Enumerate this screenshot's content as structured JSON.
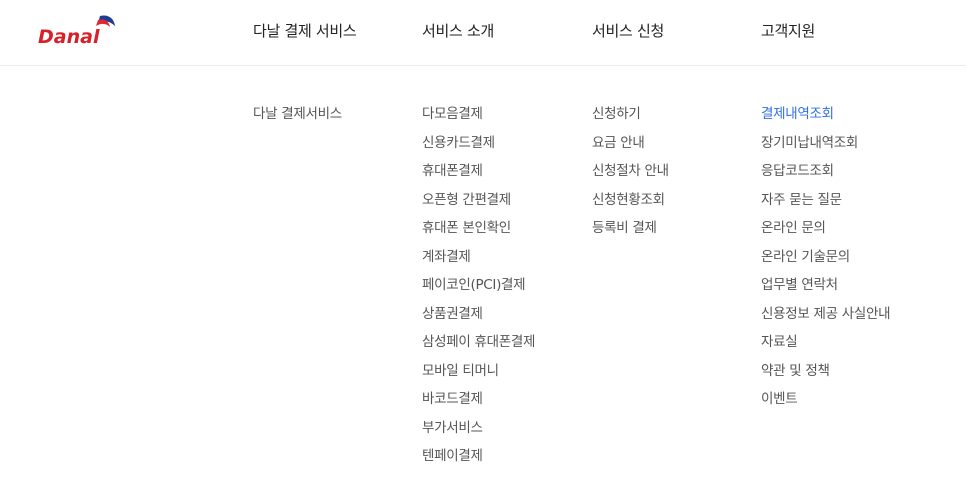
{
  "brand": {
    "logo_text": "Danal",
    "colors": {
      "text": "#d8202a",
      "wing_red": "#e4272d",
      "wing_blue": "#1b3e94"
    }
  },
  "gnb": [
    "다날 결제 서비스",
    "서비스 소개",
    "서비스 신청",
    "고객지원"
  ],
  "submenu": {
    "danal_payment": [
      "다날 결제서비스"
    ],
    "service_intro": [
      "다모음결제",
      "신용카드결제",
      "휴대폰결제",
      "오픈형 간편결제",
      "휴대폰 본인확인",
      "계좌결제",
      "페이코인(PCI)결제",
      "상품권결제",
      "삼성페이 휴대폰결제",
      "모바일 티머니",
      "바코드결제",
      "부가서비스",
      "텐페이결제"
    ],
    "service_apply": [
      "신청하기",
      "요금 안내",
      "신청절차 안내",
      "신청현황조회",
      "등록비 결제"
    ],
    "support": [
      "결제내역조회",
      "장기미납내역조회",
      "응답코드조회",
      "자주 묻는 질문",
      "온라인 문의",
      "온라인 기술문의",
      "업무별 연락처",
      "신용정보 제공 사실안내",
      "자료실",
      "약관 및 정책",
      "이벤트"
    ]
  },
  "active_item": "결제내역조회",
  "accent_color": "#2f6fe6"
}
